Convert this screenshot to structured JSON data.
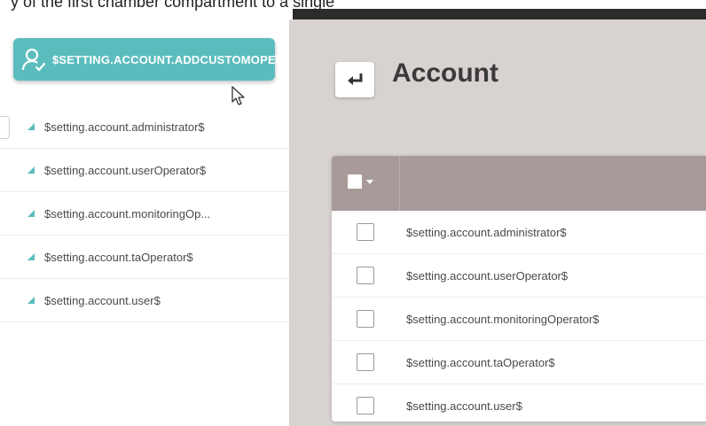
{
  "caption": "y of the first chamber compartment to a single",
  "sidebar": {
    "add_button_label": "$SETTING.ACCOUNT.ADDCUSTOMOPERATORS",
    "items": [
      {
        "label": "$setting.account.administrator$"
      },
      {
        "label": "$setting.account.userOperator$"
      },
      {
        "label": "$setting.account.monitoringOp..."
      },
      {
        "label": "$setting.account.taOperator$"
      },
      {
        "label": "$setting.account.user$"
      }
    ]
  },
  "main": {
    "title": "Account",
    "table": {
      "rows": [
        {
          "label": "$setting.account.administrator$"
        },
        {
          "label": "$setting.account.userOperator$"
        },
        {
          "label": "$setting.account.monitoringOperator$"
        },
        {
          "label": "$setting.account.taOperator$"
        },
        {
          "label": "$setting.account.user$"
        }
      ]
    }
  },
  "colors": {
    "accent": "#5bbcbd",
    "table_header": "#a99a9a",
    "main_background": "#d8d2d1"
  },
  "icons": {
    "add_button": "user-add-icon",
    "back_button": "return-arrow-icon",
    "list_item": "triangle-icon",
    "header_dropdown": "caret-down-icon",
    "pointer": "mouse-cursor-icon"
  }
}
